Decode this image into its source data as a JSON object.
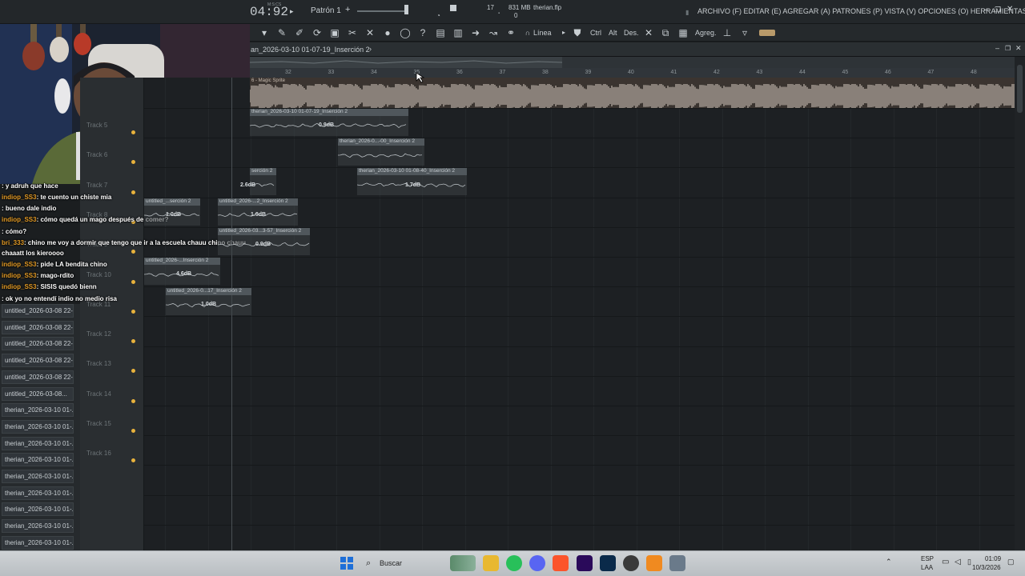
{
  "header": {
    "time": "04:92",
    "time_small": "M:S:CS",
    "pattern": "Patrón 1",
    "cpu": "17",
    "memory": "831 MB",
    "voices": "0",
    "project_file": "therian.flp",
    "menu": "ARCHIVO (F) EDITAR (E) AGREGAR (A) PATRONES (P) VISTA (V) OPCIONES (O) HERRAMIENTAS (T) AYUDA"
  },
  "toolbar": {
    "snap": "Línea",
    "ctrl": "Ctrl",
    "alt": "Alt",
    "des": "Des.",
    "agreg": "Agreg."
  },
  "playlist": {
    "title": "an_2026-03-10 01-07-19_Inserción 2",
    "ruler": [
      "32",
      "33",
      "34",
      "35",
      "36",
      "37",
      "38",
      "39",
      "40",
      "41",
      "42",
      "43",
      "44",
      "45",
      "46",
      "47",
      "48"
    ],
    "top_track_label": "6 - Magic Sprite",
    "tracks": [
      "Track 5",
      "Track 6",
      "Track 7",
      "Track 8",
      "Track 9",
      "Track 10",
      "Track 11",
      "Track 12",
      "Track 13",
      "Track 14",
      "Track 15",
      "Track 16"
    ],
    "clips": [
      {
        "label": "therian_2026-03-10 01-07-19_Inserción 2",
        "gain": "0.9dB"
      },
      {
        "label": "therian_2026-0...-00_Inserción 2",
        "gain": ""
      },
      {
        "label": "serción 2",
        "gain": "2.6dB"
      },
      {
        "label": "therian_2026-03-10 01-08-40_Inserción 2",
        "gain": "1.7dB"
      },
      {
        "label": "untitled_...serción 2",
        "gain": "1.0dB"
      },
      {
        "label": "untitled_2026-...2_Inserción 2",
        "gain": "1.0dB"
      },
      {
        "label": "untitled_2026-03...3-57_Inserción 2",
        "gain": "0.9dB"
      },
      {
        "label": "untitled_2026-...Inserción 2",
        "gain": "4.6dB"
      },
      {
        "label": "untitled_2026-0...17_Inserción 2",
        "gain": "1.0dB"
      }
    ]
  },
  "browser": {
    "items": [
      "untitled_2026-03-08 22-...",
      "untitled_2026-03-08 22-...",
      "untitled_2026-03-08 22-...",
      "untitled_2026-03-08 22-...",
      "untitled_2026-03-08 22-...",
      "untitled_2026-03-08...",
      "therian_2026-03-10 01-...",
      "therian_2026-03-10 01-...",
      "therian_2026-03-10 01-...",
      "therian_2026-03-10 01-...",
      "therian_2026-03-10 01-...",
      "therian_2026-03-10 01-...",
      "therian_2026-03-10 01-...",
      "therian_2026-03-10 01-...",
      "therian_2026-03-10 01-..."
    ]
  },
  "chat": [
    {
      "user": "",
      "msg": ": y adruh que hace"
    },
    {
      "user": "indiop_SS3",
      "msg": ": te cuento un chiste mia"
    },
    {
      "user": "",
      "msg": ": bueno dale indio"
    },
    {
      "user": "indiop_SS3",
      "msg": ": cómo quedá un mago después de comer?"
    },
    {
      "user": "",
      "msg": ": cómo?"
    },
    {
      "user": "bri_333",
      "msg": ": chino me voy a dormir que tengo que ir a la escuela chauu chino chauu"
    },
    {
      "user": "",
      "msg": "chaaatt los kieroooo"
    },
    {
      "user": "indiop_SS3",
      "msg": ": pide LA bendita chino"
    },
    {
      "user": "indiop_SS3",
      "msg": ": mago-rdito"
    },
    {
      "user": "indiop_SS3",
      "msg": ": SISIS quedó bienn"
    },
    {
      "user": "",
      "msg": ": ok yo no entendí indio no medio risa"
    }
  ],
  "taskbar": {
    "search": "Buscar",
    "lang": "ESP",
    "region": "LAA",
    "time": "01:09",
    "date": "10/3/2026"
  }
}
